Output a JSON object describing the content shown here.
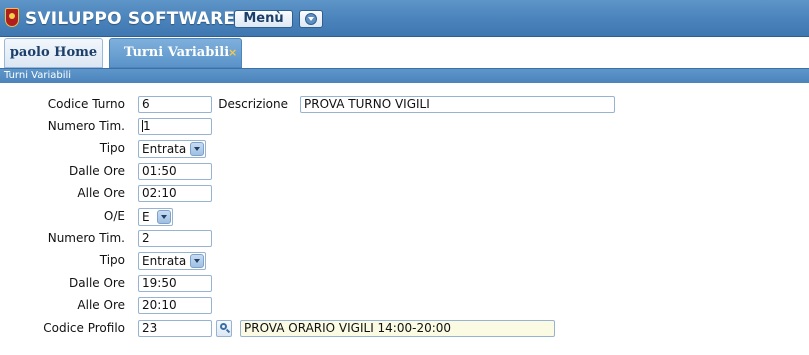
{
  "app": {
    "title": "SVILUPPO SOFTWARE",
    "menu_label": "Menù"
  },
  "tabs": [
    {
      "label": "paolo Home",
      "active": false
    },
    {
      "label": "Turni Variabili",
      "active": true,
      "close_symbol": "×"
    }
  ],
  "panel": {
    "title": "Turni Variabili"
  },
  "form": {
    "codice_turno": {
      "label": "Codice Turno",
      "value": "6"
    },
    "descrizione": {
      "label": "Descrizione",
      "value": "PROVA TURNO VIGILI"
    },
    "numero_tim_1": {
      "label": "Numero Tim.",
      "value": "1"
    },
    "tipo_1": {
      "label": "Tipo",
      "value": "Entrata"
    },
    "dalle_ore_1": {
      "label": "Dalle Ore",
      "value": "01:50"
    },
    "alle_ore_1": {
      "label": "Alle Ore",
      "value": "02:10"
    },
    "oe": {
      "label": "O/E",
      "value": "E"
    },
    "numero_tim_2": {
      "label": "Numero Tim.",
      "value": "2"
    },
    "tipo_2": {
      "label": "Tipo",
      "value": "Entrata"
    },
    "dalle_ore_2": {
      "label": "Dalle Ore",
      "value": "19:50"
    },
    "alle_ore_2": {
      "label": "Alle Ore",
      "value": "20:10"
    },
    "codice_profilo": {
      "label": "Codice Profilo",
      "value": "23",
      "description": "PROVA ORARIO VIGILI 14:00-20:00"
    }
  },
  "colors": {
    "header_blue": "#4a83bb",
    "tab_active": "#5a93c9",
    "input_border": "#98b3d1",
    "readonly_bg": "#fbfbe4",
    "close_icon": "#f3c94f"
  }
}
